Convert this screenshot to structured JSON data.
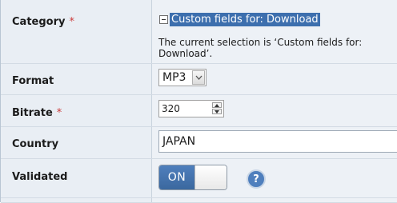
{
  "category": {
    "label": "Category",
    "required_marker": "*",
    "selected_item": "Custom fields for: Download",
    "note": "The current selection is ‘Custom fields for: Download’."
  },
  "format": {
    "label": "Format",
    "value": "MP3"
  },
  "bitrate": {
    "label": "Bitrate",
    "required_marker": "*",
    "value": "320"
  },
  "country": {
    "label": "Country",
    "value": "JAPAN"
  },
  "validated": {
    "label": "Validated",
    "toggle_text": "ON",
    "help_glyph": "?"
  },
  "colors": {
    "accent": "#3d6fae",
    "label_bg": "#e9eef4",
    "required": "#cc3b3b"
  }
}
